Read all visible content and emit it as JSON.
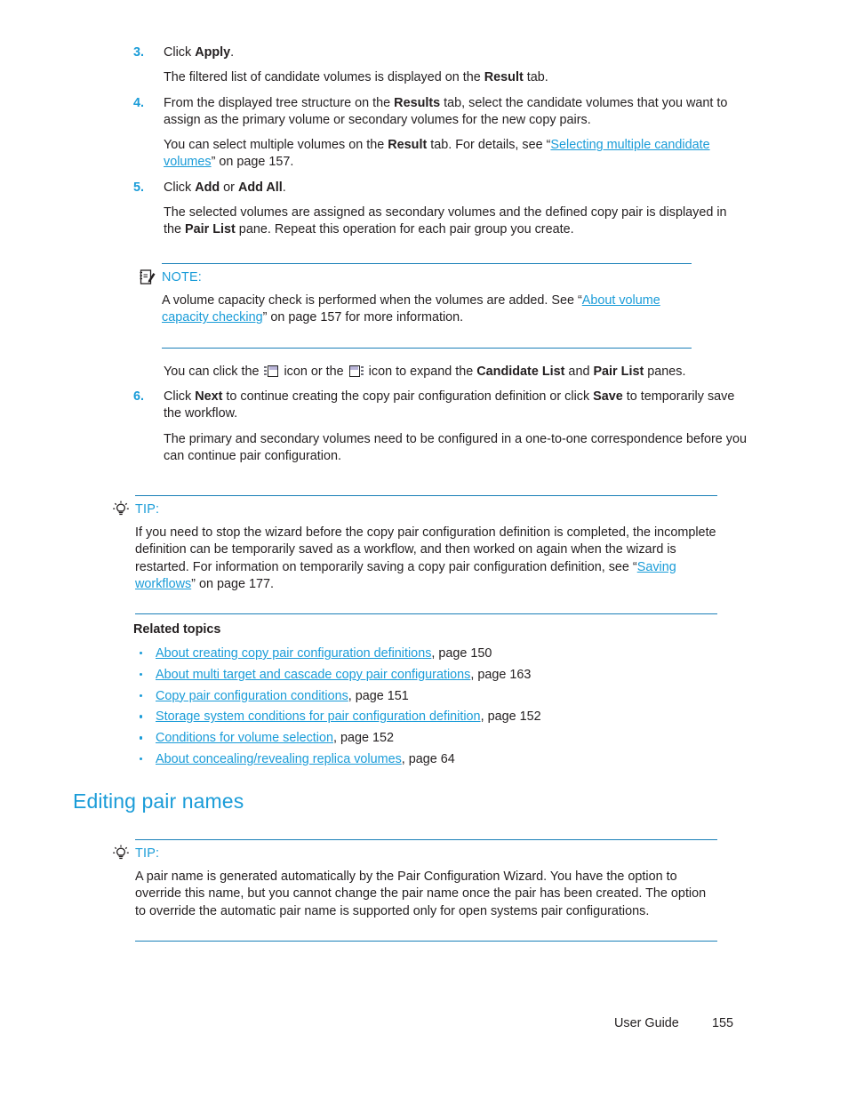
{
  "steps": [
    {
      "number": "3.",
      "paras": [
        {
          "runs": [
            {
              "t": "Click "
            },
            {
              "t": "Apply",
              "s": "b"
            },
            {
              "t": "."
            }
          ]
        },
        {
          "runs": [
            {
              "t": "The filtered list of candidate volumes is displayed on the "
            },
            {
              "t": "Result",
              "s": "b"
            },
            {
              "t": " tab."
            }
          ]
        }
      ]
    },
    {
      "number": "4.",
      "paras": [
        {
          "runs": [
            {
              "t": "From the displayed tree structure on the "
            },
            {
              "t": "Results",
              "s": "b"
            },
            {
              "t": " tab, select the candidate volumes that you want to assign as the primary volume or secondary volumes for the new copy pairs."
            }
          ]
        },
        {
          "runs": [
            {
              "t": "You can select multiple volumes on the "
            },
            {
              "t": "Result",
              "s": "b"
            },
            {
              "t": " tab. For details, see “"
            },
            {
              "t": "Selecting multiple candidate volumes",
              "s": "link"
            },
            {
              "t": "” on page 157."
            }
          ]
        }
      ]
    },
    {
      "number": "5.",
      "paras": [
        {
          "runs": [
            {
              "t": "Click "
            },
            {
              "t": "Add",
              "s": "b"
            },
            {
              "t": " or "
            },
            {
              "t": "Add All",
              "s": "b"
            },
            {
              "t": "."
            }
          ]
        },
        {
          "runs": [
            {
              "t": "The selected volumes are assigned as secondary volumes and the defined copy pair is displayed in the "
            },
            {
              "t": "Pair List",
              "s": "b"
            },
            {
              "t": " pane. Repeat this operation for each pair group you create."
            }
          ]
        }
      ]
    }
  ],
  "note_block": {
    "icon": "notepad-pencil-icon",
    "label": "NOTE:",
    "paras": [
      {
        "runs": [
          {
            "t": "A volume capacity check is performed when the volumes are added. See “"
          },
          {
            "t": "About volume capacity checking",
            "s": "link"
          },
          {
            "t": "” on page 157 for more information."
          }
        ]
      }
    ]
  },
  "after_note": {
    "runs_pre": "You can click the ",
    "icon_one": "expand-left-panel-icon",
    "runs_mid": " icon or the ",
    "icon_two": "expand-right-panel-icon",
    "runs_post_a": " icon to expand the ",
    "bold_a": "Candidate List",
    "runs_post_b": " and ",
    "bold_b": "Pair List",
    "runs_post_c": " panes."
  },
  "step6": {
    "number": "6.",
    "paras": [
      {
        "runs": [
          {
            "t": "Click "
          },
          {
            "t": "Next",
            "s": "b"
          },
          {
            "t": " to continue creating the copy pair configuration definition or click "
          },
          {
            "t": "Save",
            "s": "b"
          },
          {
            "t": " to temporarily save the workflow."
          }
        ]
      },
      {
        "runs": [
          {
            "t": "The primary and secondary volumes need to be configured in a one-to-one correspondence before you can continue pair configuration."
          }
        ]
      }
    ]
  },
  "tip_block_one": {
    "icon": "lightbulb-icon",
    "label": "TIP:",
    "paras": [
      {
        "runs": [
          {
            "t": "If you need to stop the wizard before the copy pair configuration definition is completed, the incomplete definition can be temporarily saved as a workflow, and then worked on again when the wizard is restarted. For information on temporarily saving a copy pair configuration definition, see “"
          },
          {
            "t": "Saving workflows",
            "s": "link"
          },
          {
            "t": "” on page 177."
          }
        ]
      }
    ]
  },
  "related": {
    "title": "Related topics",
    "items": [
      {
        "link": "About creating copy pair configuration definitions",
        "page": ", page 150"
      },
      {
        "link": "About multi target and cascade copy pair configurations",
        "page": ", page 163"
      },
      {
        "link": "Copy pair configuration conditions",
        "page": ", page 151"
      },
      {
        "link": "Storage system conditions for pair configuration definition",
        "page": ", page 152"
      },
      {
        "link": "Conditions for volume selection",
        "page": ", page 152"
      },
      {
        "link": "About concealing/revealing replica volumes",
        "page": ", page 64"
      }
    ]
  },
  "section_heading": "Editing pair names",
  "tip_block_two": {
    "icon": "lightbulb-icon",
    "label": "TIP:",
    "paras": [
      {
        "runs": [
          {
            "t": "A pair name is generated automatically by the Pair Configuration Wizard. You have the option to override this name, but you cannot change the pair name once the pair has been created. The option to override the automatic pair name is supported only for open systems pair configurations."
          }
        ]
      }
    ]
  },
  "footer": {
    "label": "User Guide",
    "page": "155"
  },
  "colors": {
    "accent_blue": "#1a9cd8",
    "rule_blue": "#1a80b8",
    "body_text": "#231f20"
  }
}
